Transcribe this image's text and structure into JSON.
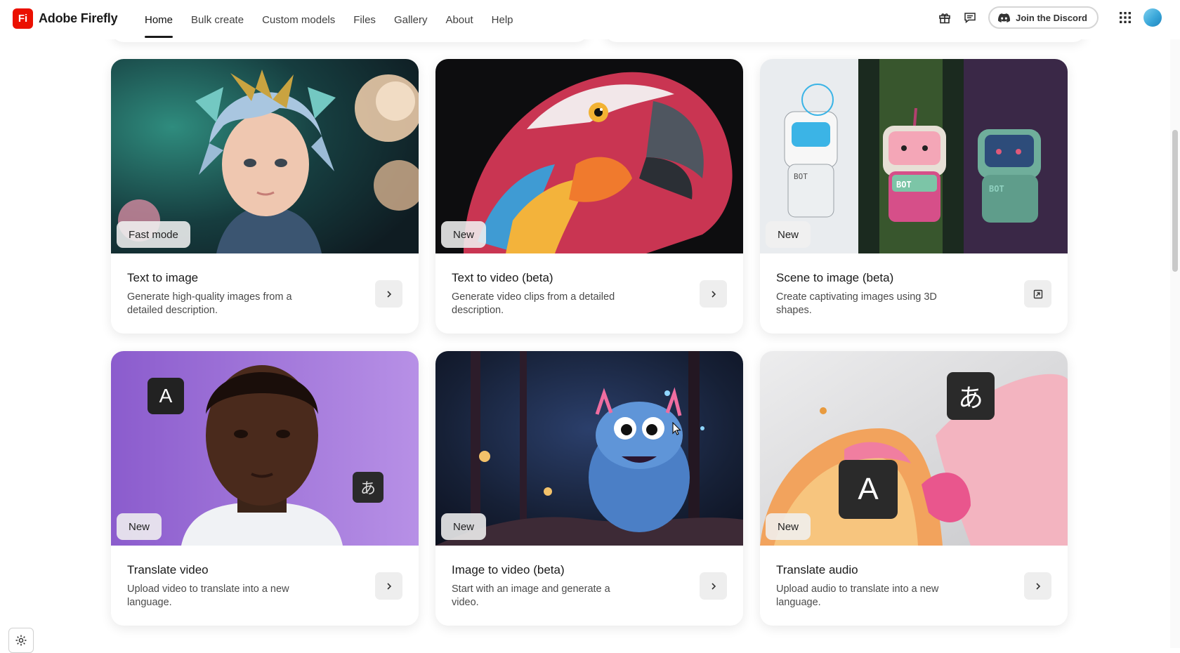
{
  "brand": {
    "logo_mark": "Fi",
    "name": "Adobe Firefly",
    "accent_color": "#eb1000"
  },
  "nav": {
    "items": [
      {
        "label": "Home",
        "active": true
      },
      {
        "label": "Bulk create",
        "active": false
      },
      {
        "label": "Custom models",
        "active": false
      },
      {
        "label": "Files",
        "active": false
      },
      {
        "label": "Gallery",
        "active": false
      },
      {
        "label": "About",
        "active": false
      },
      {
        "label": "Help",
        "active": false
      }
    ]
  },
  "header_actions": {
    "gift_icon": "gift-icon",
    "feedback_icon": "chat-icon",
    "discord_label": "Join the Discord",
    "apps_icon": "apps-grid-icon",
    "avatar": "user-avatar"
  },
  "cards": [
    {
      "badge": "Fast mode",
      "title": "Text to image",
      "description": "Generate high-quality images from a detailed description.",
      "action_icon": "chevron-right-icon"
    },
    {
      "badge": "New",
      "title": "Text to video (beta)",
      "description": "Generate video clips from a detailed description.",
      "action_icon": "chevron-right-icon"
    },
    {
      "badge": "New",
      "title": "Scene to image (beta)",
      "description": "Create captivating images using 3D shapes.",
      "action_icon": "open-external-icon"
    },
    {
      "badge": "New",
      "title": "Translate video",
      "description": "Upload video to translate into a new language.",
      "action_icon": "chevron-right-icon",
      "glyphs": [
        "A",
        "あ"
      ]
    },
    {
      "badge": "New",
      "title": "Image to video (beta)",
      "description": "Start with an image and generate a video.",
      "action_icon": "chevron-right-icon"
    },
    {
      "badge": "New",
      "title": "Translate audio",
      "description": "Upload audio to translate into a new language.",
      "action_icon": "chevron-right-icon",
      "glyphs": [
        "あ",
        "A"
      ]
    }
  ],
  "bot_labels": [
    "BOT",
    "BOT",
    "BOT"
  ],
  "settings_icon": "settings-gear-icon"
}
